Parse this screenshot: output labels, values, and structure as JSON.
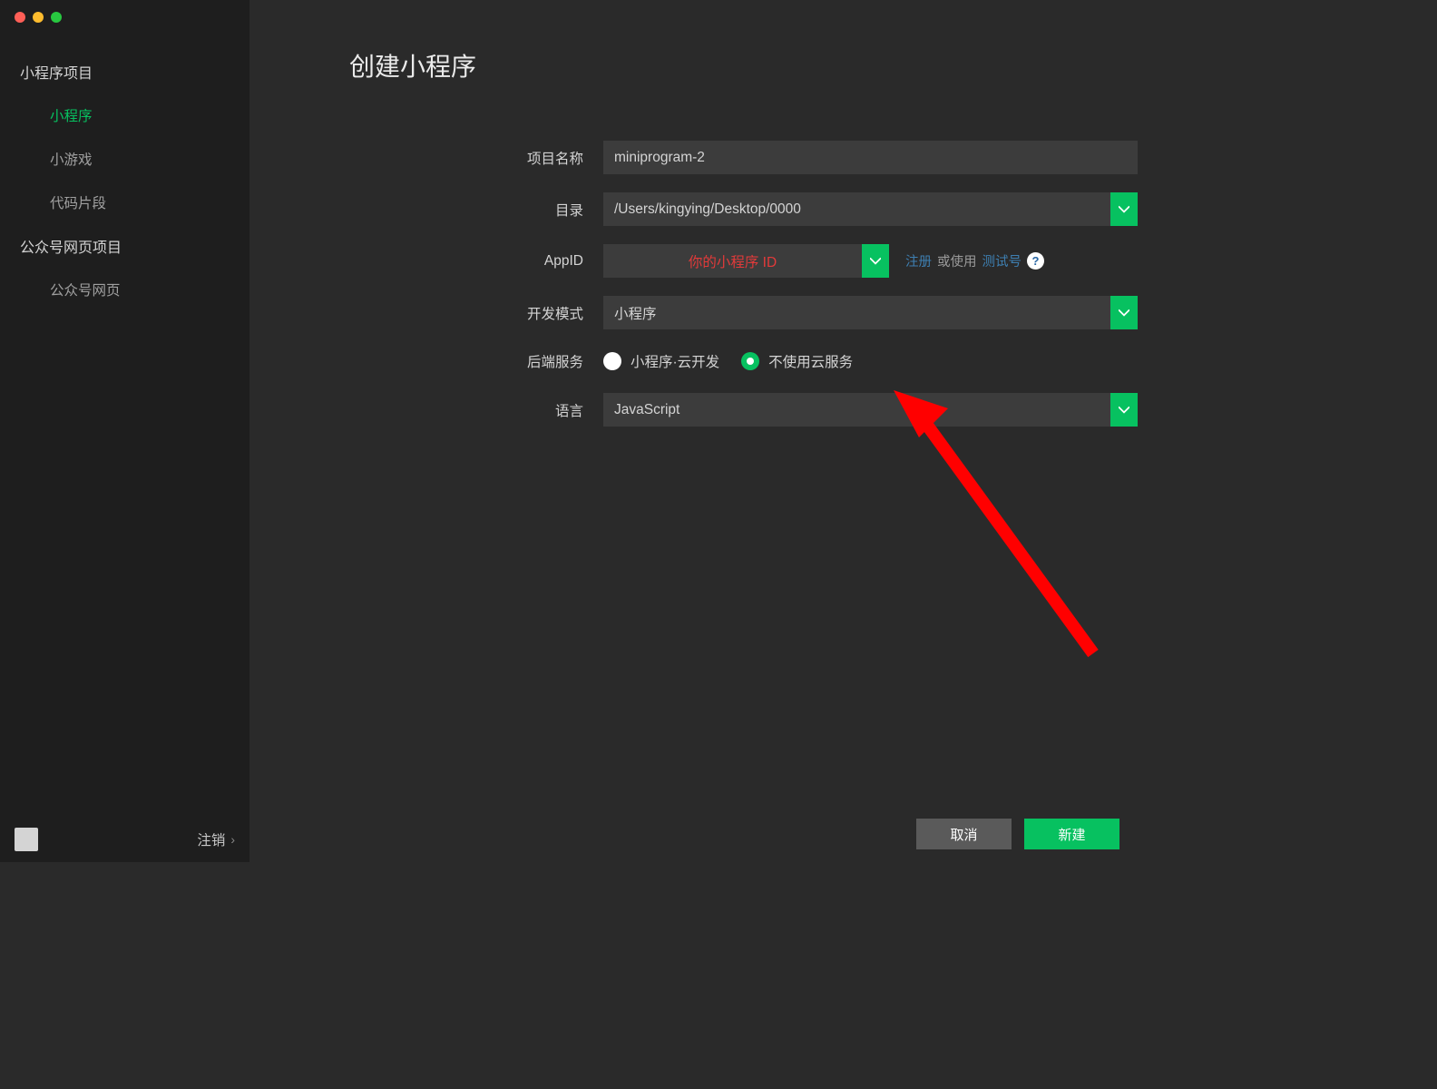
{
  "sidebar": {
    "group1_title": "小程序项目",
    "items1": [
      "小程序",
      "小游戏",
      "代码片段"
    ],
    "active_index": 0,
    "group2_title": "公众号网页项目",
    "items2": [
      "公众号网页"
    ],
    "logout_label": "注销"
  },
  "main": {
    "title": "创建小程序",
    "labels": {
      "project_name": "项目名称",
      "directory": "目录",
      "appid": "AppID",
      "dev_mode": "开发模式",
      "backend": "后端服务",
      "language": "语言"
    },
    "values": {
      "project_name": "miniprogram-2",
      "directory": "/Users/kingying/Desktop/0000",
      "appid_placeholder": "你的小程序 ID",
      "dev_mode": "小程序",
      "language": "JavaScript"
    },
    "appid_hints": {
      "register": "注册",
      "or_use": "或使用",
      "test_id": "测试号",
      "help": "?"
    },
    "backend_options": [
      "小程序·云开发",
      "不使用云服务"
    ],
    "backend_selected": 1
  },
  "footer": {
    "cancel": "取消",
    "create": "新建"
  },
  "colors": {
    "accent": "#07c160",
    "link": "#3e7fb1",
    "placeholder_red": "#e23a3a"
  }
}
